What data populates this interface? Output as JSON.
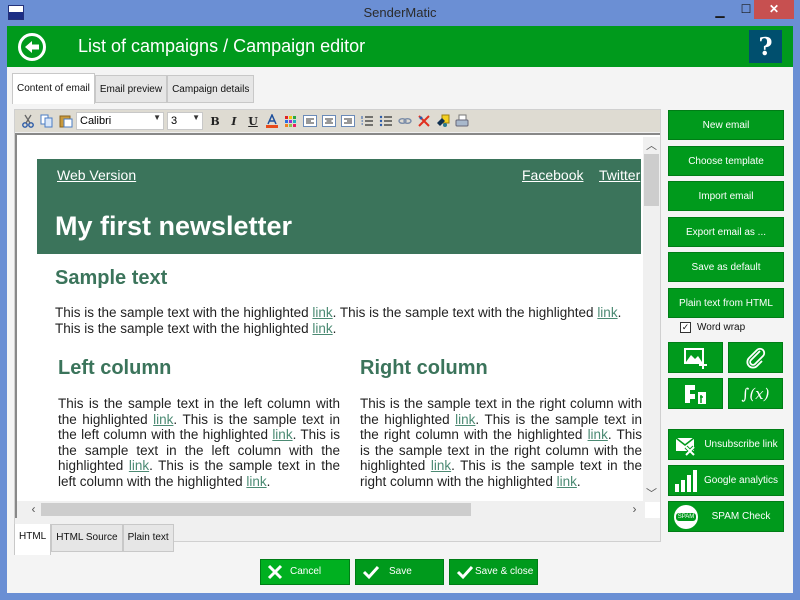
{
  "window": {
    "title": "SenderMatic",
    "minimize_label": "▁",
    "maximize_label": "☐",
    "close_label": "✕"
  },
  "header": {
    "title": "List of campaigns / Campaign editor",
    "help_label": "?"
  },
  "top_tabs": [
    {
      "label": "Content of email",
      "active": true
    },
    {
      "label": "Email preview",
      "active": false
    },
    {
      "label": "Campaign details",
      "active": false
    }
  ],
  "toolbar": {
    "font": "Calibri",
    "size": "3",
    "icons": [
      "cut-icon",
      "copy-icon",
      "paste-icon",
      "bold-icon",
      "italic-icon",
      "underline-icon",
      "font-color-icon",
      "background-color-icon",
      "align-left-icon",
      "align-center-icon",
      "align-right-icon",
      "ordered-list-icon",
      "unordered-list-icon",
      "insert-link-icon",
      "remove-format-icon",
      "fill-icon",
      "print-icon"
    ]
  },
  "newsletter": {
    "web_version": "Web Version",
    "facebook": "Facebook",
    "twitter": "Twitter",
    "title": "My first newsletter",
    "sample_title": "Sample text",
    "sample_pre1": "This is the sample text with the highlighted ",
    "link": "link",
    "sample_mid": ". This is the sample text with the highlighted ",
    "sample_end": ".",
    "sample_pre2": "This is the sample text with the highlighted ",
    "left_title": "Left column",
    "right_title": "Right column",
    "left_a": "This is the sample text in the left column with the highlighted ",
    "left_b": ". This is the sample text in the left column with the highlighted ",
    "left_c": ". This is the sample text in the left column with the highlighted ",
    "left_d": ". This is the sample text in the left column with the highlighted ",
    "right_a": "This is the sample text in the right column with the highlighted ",
    "right_b": ". This is the sample text in the right column with the highlighted ",
    "right_c": ". This is the sample text in the right column with the highlighted ",
    "right_d": ". This is the sample text in the right column with the highlighted ",
    "period": "."
  },
  "bottom_tabs": [
    {
      "label": "HTML",
      "active": true
    },
    {
      "label": "HTML Source",
      "active": false
    },
    {
      "label": "Plain text",
      "active": false
    }
  ],
  "sidebar": {
    "buttons": [
      "New email",
      "Choose template",
      "Import email",
      "Export email as ...",
      "Save as default",
      "Plain text from HTML"
    ],
    "word_wrap_label": "Word wrap",
    "word_wrap_checked": true,
    "icon_buttons": [
      "insert-image-icon",
      "attachment-icon",
      "social-icon",
      "function-icon"
    ],
    "unsubscribe_label": "Unsubscribe link",
    "analytics_label": "Google analytics",
    "spam_label": "SPAM Check",
    "spam_badge": "SPAM"
  },
  "footer": {
    "cancel": "Cancel",
    "save": "Save",
    "save_close": "Save & close"
  },
  "colors": {
    "brand_green": "#009a1c",
    "newsletter_green": "#3b745b",
    "help_blue": "#004f6e",
    "titlebar": "#6b8fd4",
    "close_red": "#c75050"
  }
}
